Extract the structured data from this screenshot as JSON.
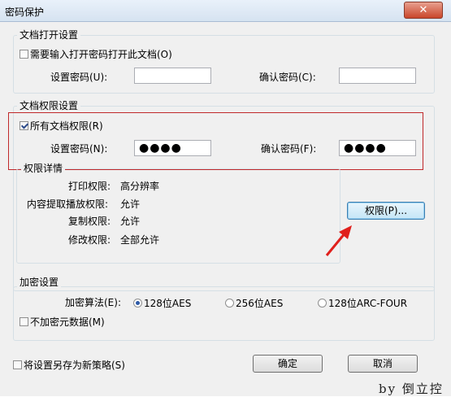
{
  "window": {
    "title": "密码保护",
    "close_glyph": "✕"
  },
  "open_settings": {
    "title": "文档打开设置",
    "require_password_label": "需要输入打开密码打开此文档(O)",
    "require_password_checked": false,
    "set_password_label": "设置密码(U):",
    "set_password_value": "",
    "confirm_password_label": "确认密码(C):",
    "confirm_password_value": ""
  },
  "permission_settings": {
    "title": "文档权限设置",
    "all_permissions_label": "所有文档权限(R)",
    "all_permissions_checked": true,
    "set_password_label": "设置密码(N):",
    "set_password_value": "●●●●",
    "confirm_password_label": "确认密码(F):",
    "confirm_password_value": "●●●●",
    "details": {
      "title": "权限详情",
      "rows": [
        {
          "label": "打印权限:",
          "value": "高分辨率"
        },
        {
          "label": "内容提取播放权限:",
          "value": "允许"
        },
        {
          "label": "复制权限:",
          "value": "允许"
        },
        {
          "label": "修改权限:",
          "value": "全部允许"
        }
      ]
    },
    "permissions_button": "权限(P)..."
  },
  "encryption": {
    "title": "加密设置",
    "algorithm_label": "加密算法(E):",
    "options": [
      "128位AES",
      "256位AES",
      "128位ARC-FOUR"
    ],
    "selected_index": 0,
    "no_metadata_label": "不加密元数据(M)",
    "no_metadata_checked": false
  },
  "footer": {
    "save_policy_label": "将设置另存为新策略(S)",
    "save_policy_checked": false,
    "ok_button": "确定",
    "cancel_button": "取消"
  },
  "watermark": "by 倒立控",
  "colors": {
    "highlight": "#c0282a",
    "arrow": "#e0201c",
    "title_bg": "#dbe7f4"
  }
}
